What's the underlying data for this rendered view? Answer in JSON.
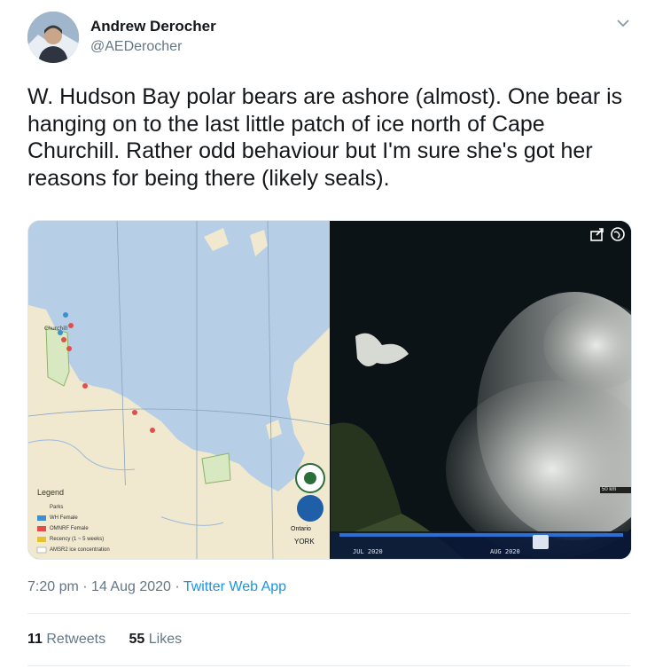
{
  "author": {
    "name": "Andrew Derocher",
    "handle": "@AEDerocher"
  },
  "tweet": {
    "text": "W. Hudson Bay polar bears are ashore (almost). One bear is hanging on to the last little patch of ice north of Cape Churchill. Rather odd behaviour but I'm sure she's got her reasons for being there (likely seals).",
    "time": "7:20 pm",
    "date": "14 Aug 2020",
    "separator": "·",
    "app": "Twitter Web App"
  },
  "map": {
    "place_label": "Churchill",
    "legend_title": "Legend",
    "legend_items": [
      "Parks",
      "WH Female",
      "OMNRF Female",
      "Recency (1 ~ 5 weeks)",
      "AMSR2 ice concentration"
    ],
    "logos": [
      "Ontario",
      "YORK"
    ]
  },
  "satellite": {
    "scale_km": "50 km",
    "timeline_labels": [
      "JUL 2020",
      "AUG 2020"
    ]
  },
  "stats": {
    "retweets_count": "11",
    "retweets_label": "Retweets",
    "likes_count": "55",
    "likes_label": "Likes"
  },
  "colors": {
    "link": "#1b95e0",
    "secondary_text": "#657786",
    "water": "#b7cfe6",
    "land": "#f0e9cf",
    "park": "#d8e8c0"
  }
}
